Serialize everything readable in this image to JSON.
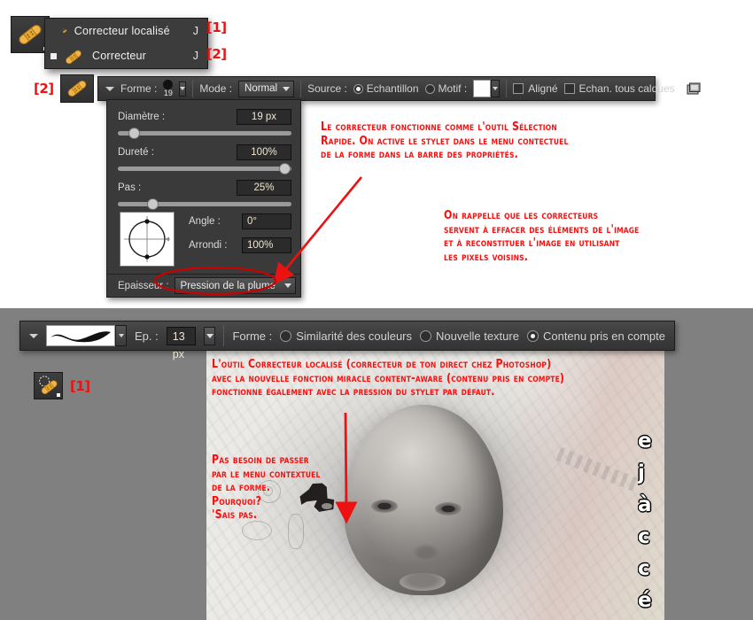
{
  "tool_flyout": {
    "items": [
      {
        "label": "Correcteur localisé",
        "shortcut": "J",
        "tag": "[1]",
        "selected": false
      },
      {
        "label": "Correcteur",
        "shortcut": "J",
        "tag": "[2]",
        "selected": true
      }
    ]
  },
  "options_bar_healing": {
    "tag": "[2]",
    "forme_label": "Forme :",
    "brush_size": "19",
    "mode_label": "Mode :",
    "mode_value": "Normal",
    "source_label": "Source :",
    "source_options": [
      {
        "label": "Echantillon",
        "selected": true
      },
      {
        "label": "Motif :",
        "selected": false
      }
    ],
    "aligne_label": "Aligné",
    "aligne_checked": false,
    "echan_label": "Echan. tous calques",
    "echan_checked": false,
    "tablet_icon": "tablet-pressure-icon"
  },
  "brush_panel": {
    "rows": [
      {
        "label": "Diamètre :",
        "value": "19 px",
        "knob_pct": 8
      },
      {
        "label": "Dureté :",
        "value": "100%",
        "knob_pct": 98
      },
      {
        "label": "Pas :",
        "value": "25%",
        "knob_pct": 22
      }
    ],
    "angle_label": "Angle :",
    "angle_value": "0°",
    "arrondi_label": "Arrondi :",
    "arrondi_value": "100%",
    "epaisseur_label": "Epaisseur :",
    "epaisseur_value": "Pression de la plume"
  },
  "options_bar_spot": {
    "thickness_label": "Ep. :",
    "thickness_value": "13 px",
    "forme_label": "Forme :",
    "forme_options": [
      {
        "label": "Similarité des couleurs",
        "selected": false
      },
      {
        "label": "Nouvelle texture",
        "selected": false
      },
      {
        "label": "Contenu pris en compte",
        "selected": true
      }
    ]
  },
  "spot_tool": {
    "tag": "[1]"
  },
  "annotations": {
    "top_right": "Le correcteur fonctionne comme l'outil Sélection\nRapide. On active le stylet dans le menu contectuel\nde la forme dans la barre des propriétés.",
    "mid_right": "On rappelle que les correcteurs\nservent à effacer des éléments de l'image\net à reconstituer l'image en utilisant\nles pixels voisins.",
    "photo_top": "L'outil Correcteur localisé (correcteur de ton direct chez Photoshop)\navec la nouvelle fonction miracle content-aware (contenu pris en compte)\nfonctionne également avec la pression du stylet par défaut.",
    "photo_left": "Pas besoin de passer\npar le menu contextuel\nde la forme.\nPourquoi?\n'Sais pas.",
    "color": "#ff0d0d"
  },
  "photo": {
    "edge_text": "e\nj\nà\nc\nc\né"
  },
  "colors": {
    "panel_bg": "#3a3a3a",
    "stage_gray": "#808080",
    "page_bg": "#ffffff",
    "annotation_red": "#ff0d0d",
    "highlight_circle": "#cc0000"
  }
}
